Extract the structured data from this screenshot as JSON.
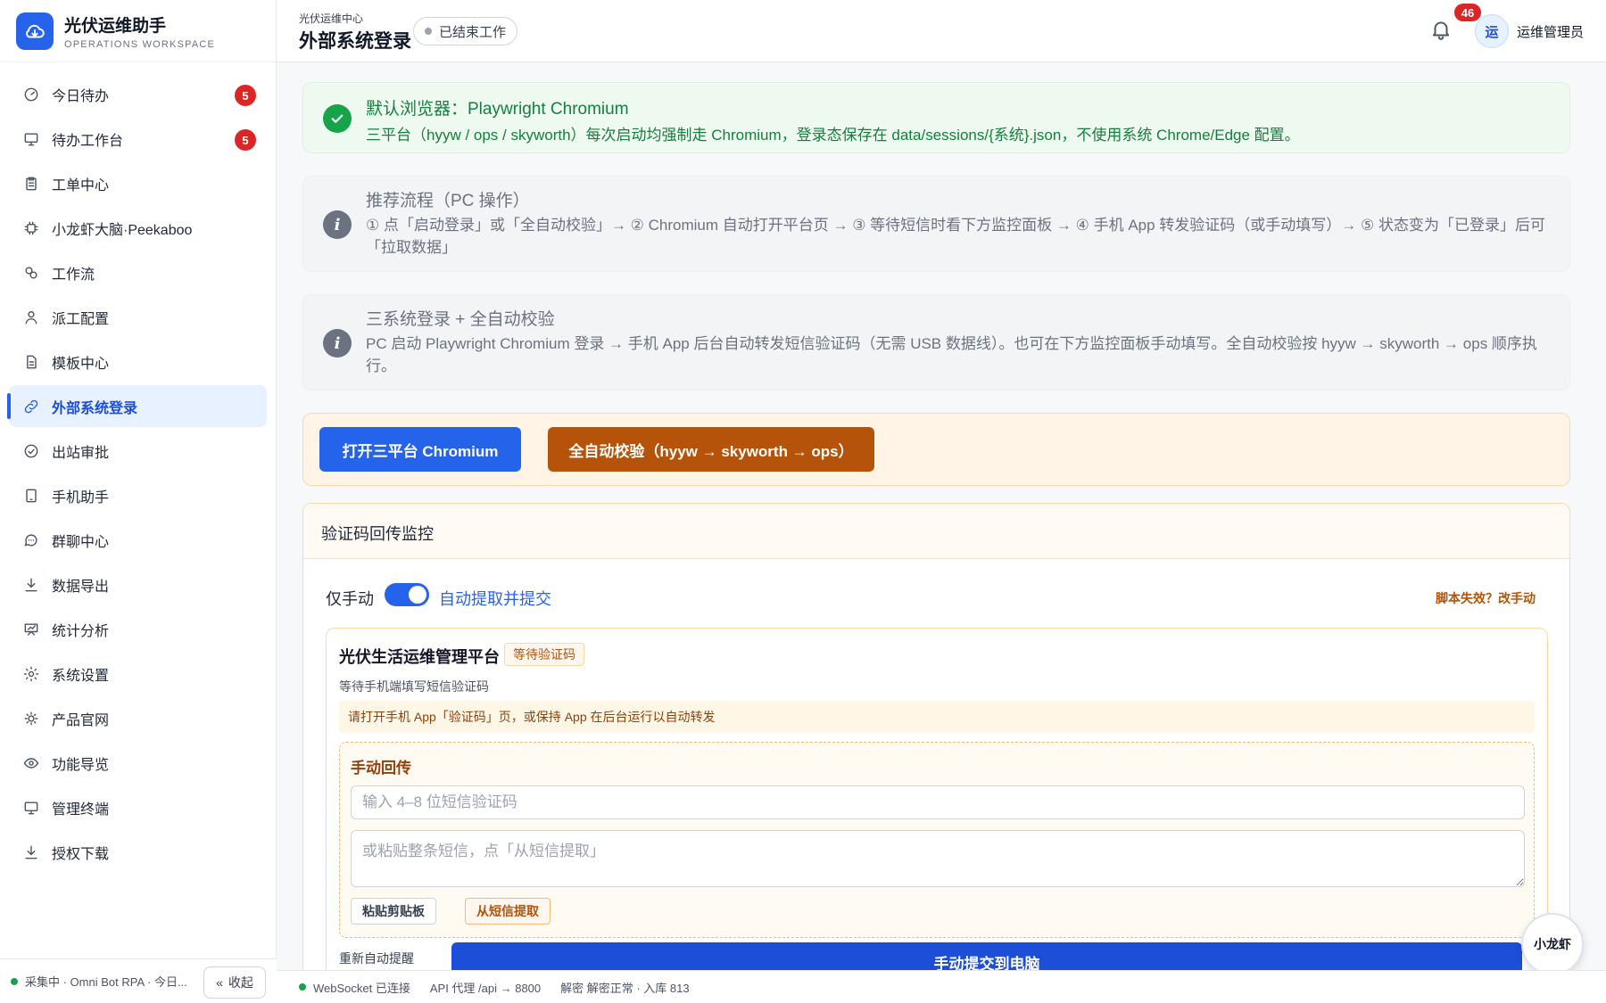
{
  "brand": {
    "title": "光伏运维助手",
    "subtitle": "OPERATIONS WORKSPACE"
  },
  "sidebar": {
    "items": [
      {
        "label": "今日待办",
        "icon": "gauge-icon",
        "badge": "5"
      },
      {
        "label": "待办工作台",
        "icon": "monitor-icon",
        "badge": "5"
      },
      {
        "label": "工单中心",
        "icon": "clipboard-icon"
      },
      {
        "label": "小龙虾大脑·Peekaboo",
        "icon": "chip-icon"
      },
      {
        "label": "工作流",
        "icon": "flow-icon"
      },
      {
        "label": "派工配置",
        "icon": "user-icon"
      },
      {
        "label": "模板中心",
        "icon": "document-icon"
      },
      {
        "label": "外部系统登录",
        "icon": "link-icon",
        "active": true
      },
      {
        "label": "出站审批",
        "icon": "check-circle-icon"
      },
      {
        "label": "手机助手",
        "icon": "tablet-icon"
      },
      {
        "label": "群聊中心",
        "icon": "chat-icon"
      },
      {
        "label": "数据导出",
        "icon": "download-icon"
      },
      {
        "label": "统计分析",
        "icon": "chart-icon"
      },
      {
        "label": "系统设置",
        "icon": "gear-icon"
      },
      {
        "label": "产品官网",
        "icon": "sun-icon"
      },
      {
        "label": "功能导览",
        "icon": "eye-icon"
      },
      {
        "label": "管理终端",
        "icon": "monitor-icon"
      },
      {
        "label": "授权下载",
        "icon": "download-icon"
      }
    ],
    "footer_status": "采集中 · Omni Bot RPA · 今日...",
    "collapse_label": "收起"
  },
  "header": {
    "crumb": "光伏运维中心",
    "title": "外部系统登录",
    "status": "已结束工作",
    "notification_count": "46",
    "avatar_text": "运",
    "user_name": "运维管理员"
  },
  "alerts": {
    "browser": {
      "title": "默认浏览器：Playwright Chromium",
      "body": "三平台（hyyw / ops / skyworth）每次启动均强制走 Chromium，登录态保存在 data/sessions/{系统}.json，不使用系统 Chrome/Edge 配置。"
    },
    "flow": {
      "title": "推荐流程（PC 操作）",
      "body": "① 点「启动登录」或「全自动校验」→ ② Chromium 自动打开平台页 → ③ 等待短信时看下方监控面板 → ④ 手机 App 转发验证码（或手动填写）→ ⑤ 状态变为「已登录」后可「拉取数据」"
    },
    "three": {
      "title": "三系统登录 + 全自动校验",
      "body": "PC 启动 Playwright Chromium 登录 → 手机 App 后台自动转发短信验证码（无需 USB 数据线）。也可在下方监控面板手动填写。全自动校验按 hyyw → skyworth → ops 顺序执行。"
    }
  },
  "actions": {
    "open_label": "打开三平台 Chromium",
    "auto_label": "全自动校验（hyyw → skyworth → ops）"
  },
  "monitor": {
    "title": "验证码回传监控",
    "mode_manual": "仅手动",
    "mode_auto": "自动提取并提交",
    "fallback": "脚本失效？改手动",
    "platform": {
      "name": "光伏生活运维管理平台",
      "tag": "等待验证码",
      "desc": "等待手机端填写短信验证码",
      "hint": "请打开手机 App「验证码」页，或保持 App 在后台运行以自动转发",
      "manual_title": "手动回传",
      "code_placeholder": "输入 4–8 位短信验证码",
      "sms_placeholder": "或粘贴整条短信，点「从短信提取」",
      "paste_label": "粘贴剪贴板",
      "extract_label": "从短信提取",
      "resend_label": "重新自动提醒",
      "submit_label": "手动提交到电脑"
    }
  },
  "float_button": "小龙虾",
  "statusbar": {
    "ws": "WebSocket 已连接",
    "api": "API 代理 /api → 8800",
    "decrypt": "解密 解密正常 · 入库 813"
  },
  "colors": {
    "accent": "#2563eb",
    "warning": "#b45309",
    "success": "#15803d",
    "danger": "#dc2626"
  }
}
